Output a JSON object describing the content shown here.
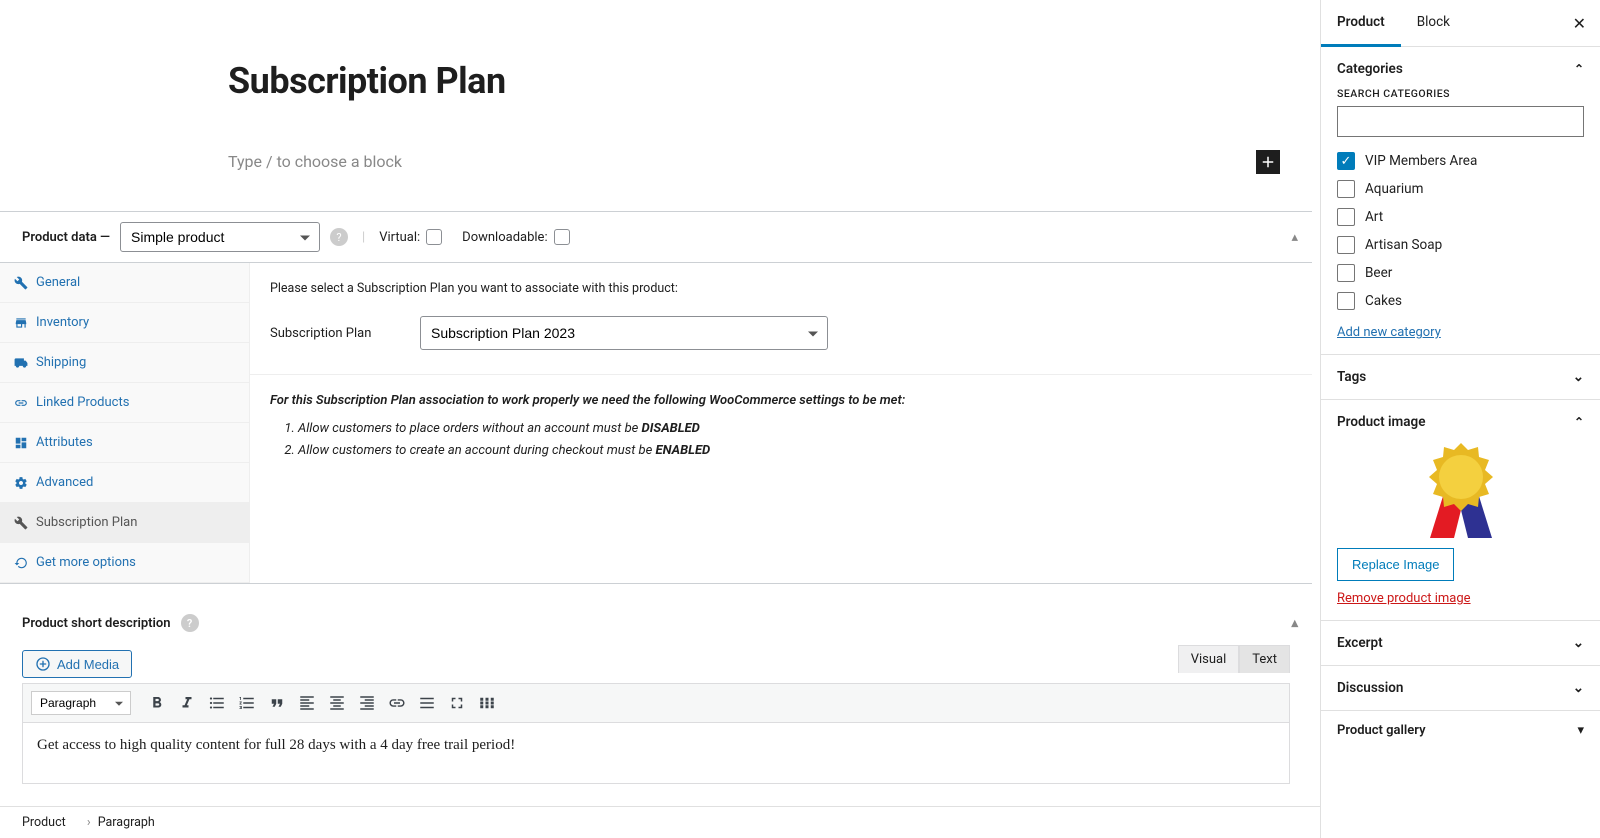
{
  "title": "Subscription Plan",
  "blockPlaceholder": "Type / to choose a block",
  "productData": {
    "label": "Product data —",
    "typeSelect": "Simple product",
    "virtualLabel": "Virtual:",
    "downloadableLabel": "Downloadable:",
    "tabs": {
      "general": "General",
      "inventory": "Inventory",
      "shipping": "Shipping",
      "linked": "Linked Products",
      "attributes": "Attributes",
      "advanced": "Advanced",
      "subscriptionPlan": "Subscription Plan",
      "getMore": "Get more options"
    },
    "instruction": "Please select a Subscription Plan you want to associate with this product:",
    "rowLabel": "Subscription Plan",
    "rowValue": "Subscription Plan 2023",
    "noteHead": "For this Subscription Plan association to work properly we need the following WooCommerce settings to be met:",
    "note1a": "Allow customers to place orders without an account must be ",
    "note1b": "DISABLED",
    "note2a": "Allow customers to create an account during checkout must be ",
    "note2b": "ENABLED"
  },
  "shortDesc": {
    "heading": "Product short description",
    "addMedia": "Add Media",
    "tabVisual": "Visual",
    "tabText": "Text",
    "formatSelect": "Paragraph",
    "content": "Get access to high quality content for full 28 days with a 4 day free trail period!"
  },
  "breadcrumb": {
    "item1": "Product",
    "item2": "Paragraph"
  },
  "rightSidebar": {
    "tabProduct": "Product",
    "tabBlock": "Block",
    "categories": {
      "heading": "Categories",
      "searchLabel": "SEARCH CATEGORIES",
      "items": {
        "vip": "VIP Members Area",
        "aquarium": "Aquarium",
        "art": "Art",
        "soap": "Artisan Soap",
        "beer": "Beer",
        "cakes": "Cakes"
      },
      "addNew": "Add new category"
    },
    "tags": "Tags",
    "productImage": {
      "heading": "Product image",
      "replace": "Replace Image",
      "remove": "Remove product image"
    },
    "excerpt": "Excerpt",
    "discussion": "Discussion",
    "gallery": "Product gallery"
  }
}
